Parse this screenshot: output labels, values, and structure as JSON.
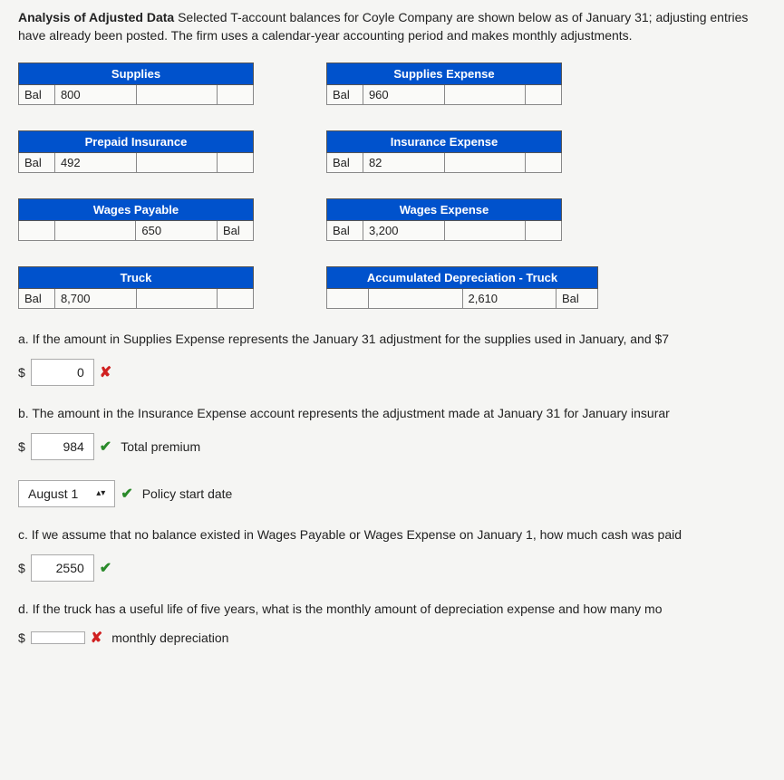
{
  "intro": {
    "title": "Analysis of Adjusted Data",
    "body": " Selected T-account balances for Coyle Company are shown below as of January 31; adjusting entries have already been posted. The firm uses a calendar-year accounting period and makes monthly adjustments."
  },
  "accounts": {
    "supplies": {
      "name": "Supplies",
      "leftLabel": "Bal",
      "leftVal": "800",
      "rightVal": "",
      "rightLabel": ""
    },
    "supplies_expense": {
      "name": "Supplies Expense",
      "leftLabel": "Bal",
      "leftVal": "960",
      "rightVal": "",
      "rightLabel": ""
    },
    "prepaid_insurance": {
      "name": "Prepaid Insurance",
      "leftLabel": "Bal",
      "leftVal": "492",
      "rightVal": "",
      "rightLabel": ""
    },
    "insurance_expense": {
      "name": "Insurance Expense",
      "leftLabel": "Bal",
      "leftVal": "82",
      "rightVal": "",
      "rightLabel": ""
    },
    "wages_payable": {
      "name": "Wages Payable",
      "leftLabel": "",
      "leftVal": "",
      "rightVal": "650",
      "rightLabel": "Bal"
    },
    "wages_expense": {
      "name": "Wages Expense",
      "leftLabel": "Bal",
      "leftVal": "3,200",
      "rightVal": "",
      "rightLabel": ""
    },
    "truck": {
      "name": "Truck",
      "leftLabel": "Bal",
      "leftVal": "8,700",
      "rightVal": "",
      "rightLabel": ""
    },
    "accum_dep_truck": {
      "name": "Accumulated Depreciation - Truck",
      "leftLabel": "",
      "leftVal": "",
      "rightVal": "2,610",
      "rightLabel": "Bal"
    }
  },
  "questions": {
    "a": {
      "text": "a. If the amount in Supplies Expense represents the January 31 adjustment for the supplies used in January, and $7",
      "answer": "0",
      "mark": "wrong"
    },
    "b": {
      "text": "b. The amount in the Insurance Expense account represents the adjustment made at January 31 for January insurar",
      "answer1": "984",
      "label1": "Total premium",
      "answer2": "August 1",
      "label2": "Policy start date"
    },
    "c": {
      "text": "c. If we assume that no balance existed in Wages Payable or Wages Expense on January 1, how much cash was paid",
      "answer": "2550"
    },
    "d": {
      "text": "d. If the truck has a useful life of five years, what is the monthly amount of depreciation expense and how many mo",
      "answer": "",
      "label": "monthly depreciation"
    }
  },
  "symbols": {
    "dollar": "$",
    "check": "✔",
    "cross": "✘"
  }
}
